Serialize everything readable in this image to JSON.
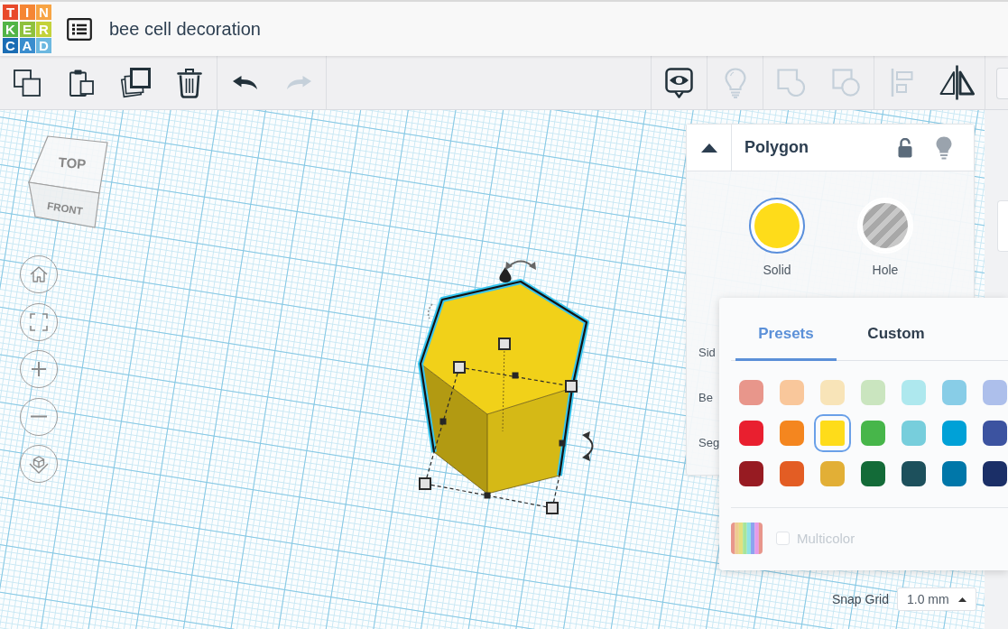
{
  "header": {
    "logo": [
      {
        "letter": "T",
        "color": "#e84a2b"
      },
      {
        "letter": "I",
        "color": "#f58634"
      },
      {
        "letter": "N",
        "color": "#f7a444"
      },
      {
        "letter": "K",
        "color": "#52b447"
      },
      {
        "letter": "E",
        "color": "#8fc13e"
      },
      {
        "letter": "R",
        "color": "#c3d23a"
      },
      {
        "letter": "C",
        "color": "#1b6db4"
      },
      {
        "letter": "A",
        "color": "#3a8dce"
      },
      {
        "letter": "D",
        "color": "#6cb8e0"
      }
    ],
    "title": "bee cell decoration"
  },
  "toolbar": {
    "left_groups": [
      [
        {
          "kind": "copy",
          "disabled": false
        },
        {
          "kind": "paste",
          "disabled": false
        },
        {
          "kind": "duplicate",
          "disabled": false
        },
        {
          "kind": "delete",
          "disabled": false
        }
      ],
      [
        {
          "kind": "undo",
          "disabled": false
        },
        {
          "kind": "redo",
          "disabled": true
        }
      ]
    ],
    "right_groups": [
      [
        {
          "kind": "notes",
          "disabled": false
        }
      ],
      [
        {
          "kind": "light",
          "disabled": true
        }
      ],
      [
        {
          "kind": "group",
          "disabled": true
        },
        {
          "kind": "ungroup",
          "disabled": true
        }
      ],
      [
        {
          "kind": "align",
          "disabled": true
        },
        {
          "kind": "mirror",
          "disabled": false
        }
      ]
    ]
  },
  "view_cube": {
    "top": "TOP",
    "front": "FRONT"
  },
  "view_controls": [
    {
      "kind": "home"
    },
    {
      "kind": "fit"
    },
    {
      "kind": "zoom_in"
    },
    {
      "kind": "zoom_out"
    },
    {
      "kind": "projection"
    }
  ],
  "shape": {
    "selected": true
  },
  "inspector": {
    "title": "Polygon",
    "locked": false,
    "modes": [
      {
        "kind": "solid",
        "label": "Solid",
        "selected": true
      },
      {
        "kind": "hole",
        "label": "Hole",
        "selected": false
      }
    ],
    "property_labels": [
      "Sid",
      "Be",
      "Seg"
    ]
  },
  "color_picker": {
    "tabs": [
      {
        "label": "Presets",
        "selected": true
      },
      {
        "label": "Custom",
        "selected": false
      }
    ],
    "swatches": [
      [
        {
          "color": "#e8968b",
          "selected": false
        },
        {
          "color": "#f9c79b",
          "selected": false
        },
        {
          "color": "#f8e4b8",
          "selected": false
        },
        {
          "color": "#cae5bf",
          "selected": false
        },
        {
          "color": "#aee8ee",
          "selected": false
        },
        {
          "color": "#88cde7",
          "selected": false
        },
        {
          "color": "#adbfeb",
          "selected": false
        }
      ],
      [
        {
          "color": "#e91f2f",
          "selected": false
        },
        {
          "color": "#f4861f",
          "selected": false
        },
        {
          "color": "#fedc1a",
          "selected": true
        },
        {
          "color": "#47b64a",
          "selected": false
        },
        {
          "color": "#77cedc",
          "selected": false
        },
        {
          "color": "#00a1d7",
          "selected": false
        },
        {
          "color": "#3c53a0",
          "selected": false
        }
      ],
      [
        {
          "color": "#971b22",
          "selected": false
        },
        {
          "color": "#e35d24",
          "selected": false
        },
        {
          "color": "#e2af36",
          "selected": false
        },
        {
          "color": "#136b38",
          "selected": false
        },
        {
          "color": "#1d505c",
          "selected": false
        },
        {
          "color": "#0077a9",
          "selected": false
        },
        {
          "color": "#1b2f67",
          "selected": false
        }
      ]
    ],
    "multicolor": {
      "label": "Multicolor",
      "checked": false,
      "disabled": true
    }
  },
  "snap_grid": {
    "label": "Snap Grid",
    "value": "1.0 mm"
  }
}
